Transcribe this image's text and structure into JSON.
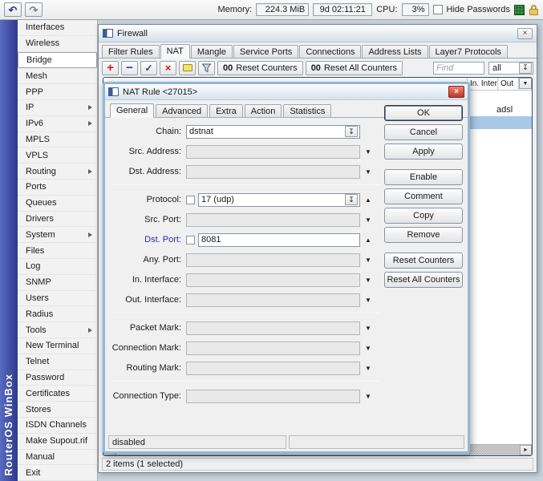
{
  "topbar": {
    "memory_label": "Memory:",
    "memory_value": "224.3 MiB",
    "uptime": "9d 02:11:21",
    "cpu_label": "CPU:",
    "cpu_value": "3%",
    "hide_passwords_label": "Hide Passwords"
  },
  "brand": "RouterOS WinBox",
  "icons": {
    "undo": "↶",
    "redo": "↷",
    "close": "×",
    "add": "+",
    "remove": "−",
    "enable_check": "✓",
    "disable_cross": "×",
    "dropdown_bar": "↧",
    "arrow_down": "▼",
    "arrow_up": "▲",
    "scroll_left": "◄",
    "scroll_right": "►"
  },
  "colors": {
    "brand_blue": "#3a4a9f",
    "selected_row": "#a8c8e8",
    "modified_label": "#2a2ab0",
    "close_red": "#c03828"
  },
  "sidebar": {
    "items": [
      {
        "label": "Interfaces"
      },
      {
        "label": "Wireless"
      },
      {
        "label": "Bridge",
        "selected": true
      },
      {
        "label": "Mesh"
      },
      {
        "label": "PPP"
      },
      {
        "label": "IP",
        "submenu": true
      },
      {
        "label": "IPv6",
        "submenu": true
      },
      {
        "label": "MPLS"
      },
      {
        "label": "VPLS"
      },
      {
        "label": "Routing",
        "submenu": true
      },
      {
        "label": "Ports"
      },
      {
        "label": "Queues"
      },
      {
        "label": "Drivers"
      },
      {
        "label": "System",
        "submenu": true
      },
      {
        "label": "Files"
      },
      {
        "label": "Log"
      },
      {
        "label": "SNMP"
      },
      {
        "label": "Users"
      },
      {
        "label": "Radius"
      },
      {
        "label": "Tools",
        "submenu": true
      },
      {
        "label": "New Terminal"
      },
      {
        "label": "Telnet"
      },
      {
        "label": "Password"
      },
      {
        "label": "Certificates"
      },
      {
        "label": "Stores"
      },
      {
        "label": "ISDN Channels"
      },
      {
        "label": "Make Supout.rif"
      },
      {
        "label": "Manual"
      },
      {
        "label": "Exit"
      }
    ]
  },
  "firewall": {
    "title": "Firewall",
    "tabs": [
      "Filter Rules",
      "NAT",
      "Mangle",
      "Service Ports",
      "Connections",
      "Address Lists",
      "Layer7 Protocols"
    ],
    "active_tab": "NAT",
    "toolbar": {
      "counters_zero": "00",
      "reset_counters": "Reset Counters",
      "reset_all_counters": "Reset All Counters",
      "find_placeholder": "Find",
      "filter_value": "all"
    },
    "table": {
      "columns": {
        "in_interface": "In. Inter...",
        "out_interface": "Out"
      },
      "rows": [
        {
          "out_interface": ""
        },
        {
          "out_interface": "adsl"
        },
        {
          "out_interface": "",
          "selected": true
        }
      ]
    },
    "status": "2 items (1 selected)"
  },
  "dialog": {
    "title": "NAT Rule <27015>",
    "tabs": [
      "General",
      "Advanced",
      "Extra",
      "Action",
      "Statistics"
    ],
    "active_tab": "General",
    "fields": [
      {
        "label": "Chain:",
        "value": "dstnat"
      },
      {
        "label": "Src. Address:",
        "value": ""
      },
      {
        "label": "Dst. Address:",
        "value": ""
      },
      {
        "label": "Protocol:",
        "value": "17 (udp)"
      },
      {
        "label": "Src. Port:",
        "value": ""
      },
      {
        "label": "Dst. Port:",
        "value": "8081",
        "modified": true
      },
      {
        "label": "Any. Port:",
        "value": ""
      },
      {
        "label": "In. Interface:",
        "value": ""
      },
      {
        "label": "Out. Interface:",
        "value": ""
      },
      {
        "label": "Packet Mark:",
        "value": ""
      },
      {
        "label": "Connection Mark:",
        "value": ""
      },
      {
        "label": "Routing Mark:",
        "value": ""
      },
      {
        "label": "Connection Type:",
        "value": ""
      }
    ],
    "buttons": [
      "OK",
      "Cancel",
      "Apply",
      "Enable",
      "Comment",
      "Copy",
      "Remove",
      "Reset Counters",
      "Reset All Counters"
    ],
    "status": "disabled"
  }
}
